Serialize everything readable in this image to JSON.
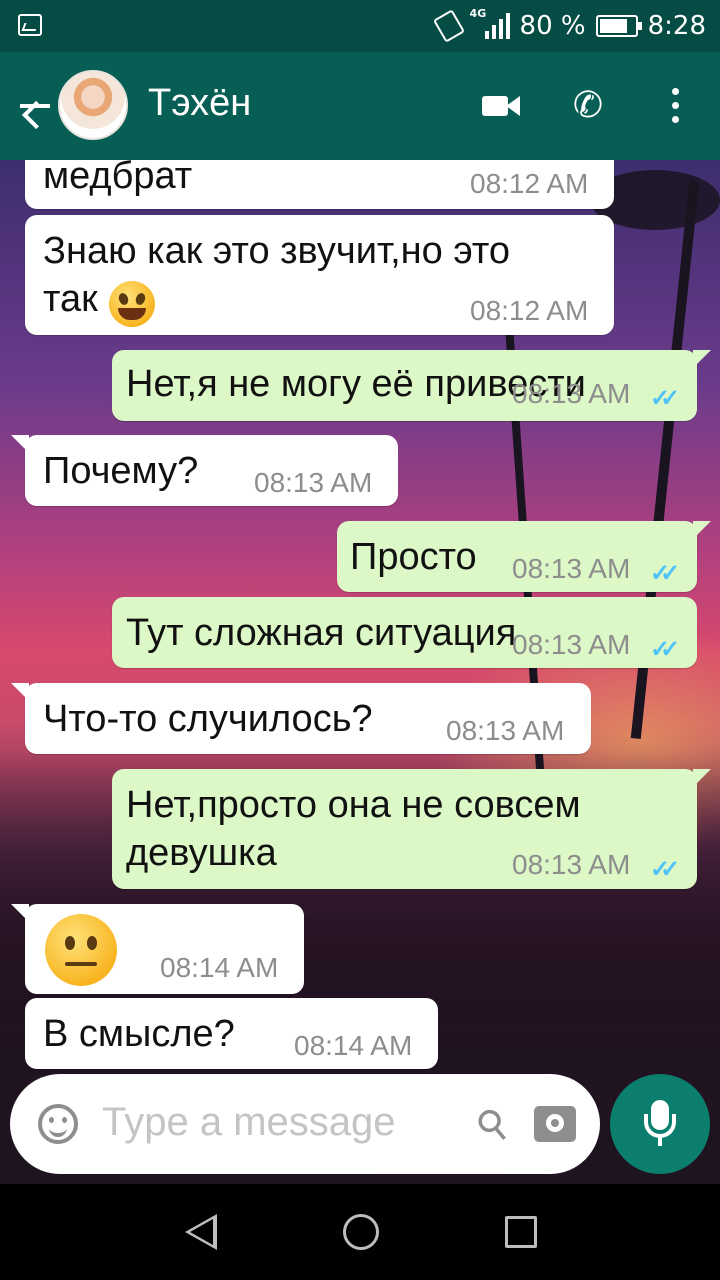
{
  "status_bar": {
    "network": "4G",
    "battery": "80 %",
    "battery_level": 0.8,
    "time": "8:28",
    "icons": [
      "image-icon",
      "vibrate-icon",
      "signal-icon",
      "battery-icon"
    ]
  },
  "header": {
    "contact_name": "Тэхён",
    "icons": [
      "back-arrow-icon",
      "video-call-icon",
      "phone-icon",
      "more-vert-icon"
    ]
  },
  "messages": [
    {
      "direction": "in",
      "lines": [
        "медбрат"
      ],
      "time": "08:12 AM"
    },
    {
      "direction": "in",
      "lines": [
        "Знаю как это звучит,но это",
        "так"
      ],
      "emoji": "😂",
      "time": "08:12 AM"
    },
    {
      "direction": "out",
      "lines": [
        "Нет,я не могу её привести"
      ],
      "time": "08:13 AM",
      "read": true
    },
    {
      "direction": "in",
      "lines": [
        "Почему?"
      ],
      "time": "08:13 AM"
    },
    {
      "direction": "out",
      "lines": [
        "Просто"
      ],
      "time": "08:13 AM",
      "read": true
    },
    {
      "direction": "out",
      "lines": [
        "Тут сложная ситуация"
      ],
      "time": "08:13 AM",
      "read": true
    },
    {
      "direction": "in",
      "lines": [
        "Что-то случилось?"
      ],
      "time": "08:13 AM"
    },
    {
      "direction": "out",
      "lines": [
        "Нет,просто она не совсем",
        "девушка"
      ],
      "time": "08:13 AM",
      "read": true
    },
    {
      "direction": "in",
      "lines": [],
      "emoji": "😐",
      "time": "08:14 AM"
    },
    {
      "direction": "in",
      "lines": [
        "В смысле?"
      ],
      "time": "08:14 AM"
    }
  ],
  "composer": {
    "placeholder": "Type a message",
    "icons": [
      "emoji-icon",
      "attach-icon",
      "camera-icon",
      "mic-icon"
    ]
  },
  "colors": {
    "header": "#075e54",
    "status_bar": "#054c44",
    "outgoing_bubble": "#dcf8c6",
    "incoming_bubble": "#ffffff",
    "read_ticks": "#4fc3f7",
    "mic_button": "#0b7e6e"
  }
}
